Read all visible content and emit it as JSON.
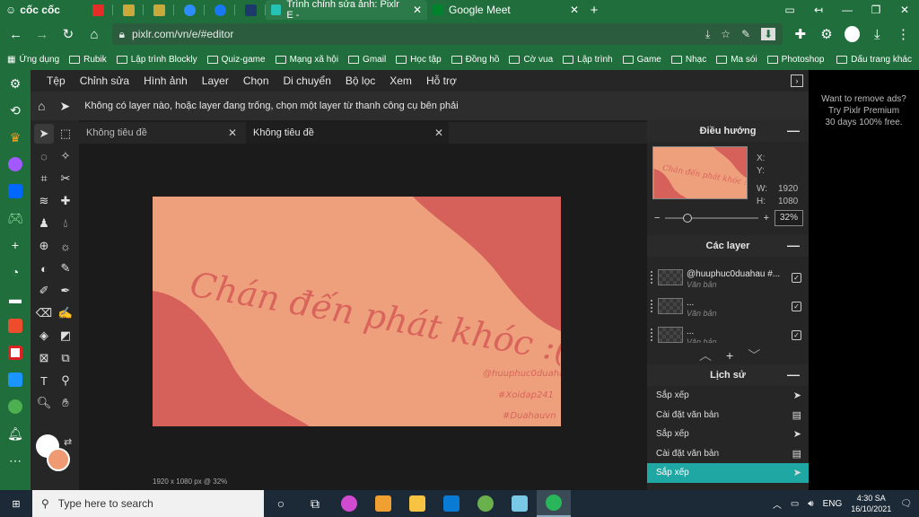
{
  "browser": {
    "brand": "cốc cốc",
    "tabs": [
      {
        "title": "Trình chỉnh sửa ảnh: Pixlr E -",
        "active": true
      },
      {
        "title": "Google Meet",
        "active": false
      }
    ],
    "url": "pixlr.com/vn/e/#editor",
    "bookmarks": [
      "Ứng dụng",
      "Rubik",
      "Lập trình Blockly",
      "Quiz-game",
      "Mạng xã hội",
      "Gmail",
      "Học tập",
      "Đồng hồ",
      "Cờ vua",
      "Lập trình",
      "Game",
      "Nhạc",
      "Ma sói",
      "Photoshop"
    ],
    "bookmarks_other": "Dấu trang khác"
  },
  "app": {
    "menu": [
      "Tệp",
      "Chỉnh sửa",
      "Hình ảnh",
      "Layer",
      "Chọn",
      "Di chuyển",
      "Bộ lọc",
      "Xem",
      "Hỗ trợ"
    ],
    "hint": "Không có layer nào, hoặc layer đang trống, chọn một layer từ thanh công cụ bên phải",
    "doc_tabs": [
      "Không tiêu đề",
      "Không tiêu đề"
    ],
    "status": "1920 x 1080 px @ 32%",
    "artwork": {
      "headline": "Chán đến phát khóc :(",
      "line1": "@huuphuc0duahau",
      "line2": "#Xoidap241",
      "line3": "#Duahauvn"
    },
    "colors": {
      "foreground": "#ffffff",
      "background": "#ef9a73",
      "accent": "#1fa8a3"
    }
  },
  "panels": {
    "navigator": {
      "title": "Điều hướng",
      "x_label": "X:",
      "y_label": "Y:",
      "w_label": "W:",
      "w_value": "1920",
      "h_label": "H:",
      "h_value": "1080",
      "zoom": "32%"
    },
    "layers": {
      "title": "Các layer",
      "items": [
        {
          "name": "@huuphuc0duahau #...",
          "type": "Văn bản"
        },
        {
          "name": "...",
          "type": "Văn bản"
        },
        {
          "name": "...",
          "type": "Văn bản"
        }
      ]
    },
    "history": {
      "title": "Lịch sử",
      "items": [
        "Sắp xếp",
        "Cài đặt văn bản",
        "Sắp xếp",
        "Cài đặt văn bản",
        "Sắp xếp"
      ]
    }
  },
  "ad": {
    "line1": "Want to remove ads?",
    "line2": "Try Pixlr Premium",
    "line3": "30 days 100% free."
  },
  "taskbar": {
    "search_placeholder": "Type here to search",
    "lang": "ENG",
    "time": "4:30 SA",
    "date": "16/10/2021"
  }
}
